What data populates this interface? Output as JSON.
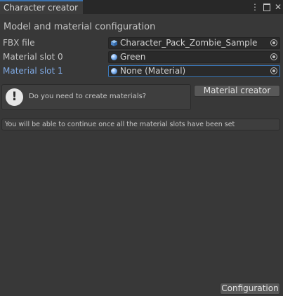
{
  "window": {
    "tab_title": "Character creator",
    "menu_glyph": "⋮",
    "close_glyph": "✕",
    "menu_icon": "kebab-menu-icon",
    "maximize_icon": "maximize-icon",
    "close_icon": "close-icon"
  },
  "section_title": "Model and material configuration",
  "fields": [
    {
      "label": "FBX file",
      "value": "Character_Pack_Zombie_Sample",
      "icon": "prefab-cube-icon",
      "focused": false
    },
    {
      "label": "Material slot 0",
      "value": "Green",
      "icon": "material-sphere-icon",
      "focused": false
    },
    {
      "label": "Material slot 1",
      "value": "None (Material)",
      "icon": "material-sphere-icon",
      "focused": true
    }
  ],
  "help": {
    "icon_glyph": "!",
    "message": "Do you need to create materials?",
    "button_label": "Material creator"
  },
  "info_message": "You will be able to continue once all the material slots have been set",
  "footer": {
    "button_label": "Configuration"
  },
  "colors": {
    "background": "#383838",
    "active_label": "#7fa9e3",
    "focus_border": "#3a79bb",
    "tab_accent": "#3a72b0"
  }
}
